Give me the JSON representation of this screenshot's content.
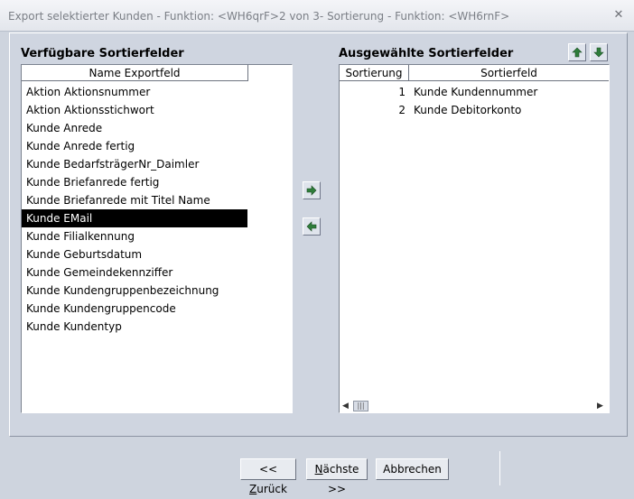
{
  "window": {
    "title": "Export selektierter Kunden - Funktion: <WH6qrF>2 von 3- Sortierung - Funktion: <WH6rnF>"
  },
  "available": {
    "heading": "Verfügbare Sortierfelder",
    "column_header": "Name Exportfeld",
    "items": [
      "Aktion Aktionsnummer",
      "Aktion Aktionsstichwort",
      "Kunde Anrede",
      "Kunde Anrede fertig",
      "Kunde BedarfsträgerNr_Daimler",
      "Kunde Briefanrede fertig",
      "Kunde Briefanrede mit Titel Name",
      "Kunde EMail",
      "Kunde Filialkennung",
      "Kunde Geburtsdatum",
      "Kunde Gemeindekennziffer",
      "Kunde Kundengruppenbezeichnung",
      "Kunde Kundengruppencode",
      "Kunde Kundentyp"
    ],
    "selected_item": "Kunde EMail"
  },
  "selected": {
    "heading": "Ausgewählte Sortierfelder",
    "column_headers": [
      "Sortierung",
      "Sortierfeld"
    ],
    "rows": [
      {
        "order": "1",
        "field": "Kunde Kundennummer"
      },
      {
        "order": "2",
        "field": "Kunde Debitorkonto"
      }
    ]
  },
  "buttons": {
    "back": {
      "prefix": "<< ",
      "accel": "Z",
      "rest": "urück"
    },
    "next": {
      "accel": "N",
      "rest": "ächste >>"
    },
    "cancel": "Abbrechen"
  },
  "icons": {
    "add": "arrow-right-icon",
    "remove": "arrow-left-icon",
    "up": "arrow-up-icon",
    "down": "arrow-down-icon",
    "close": "close-icon",
    "accent": "#2e7d3a"
  }
}
